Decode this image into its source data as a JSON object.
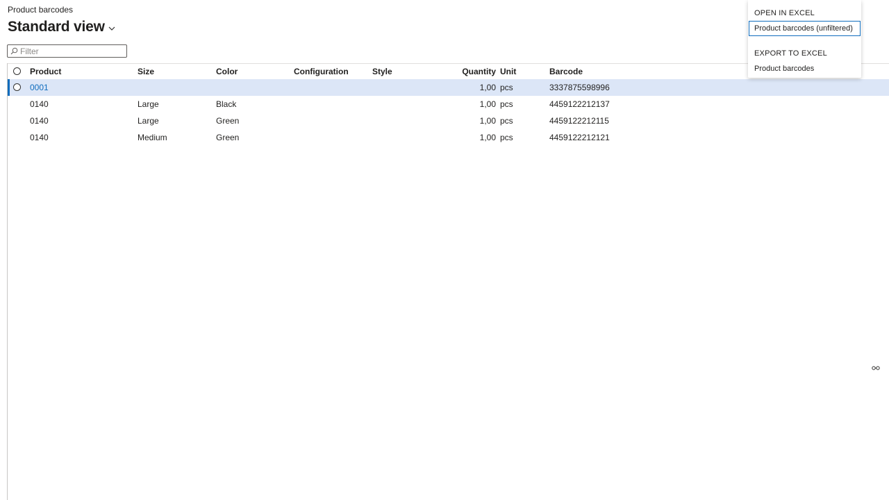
{
  "header": {
    "breadcrumb": "Product barcodes",
    "view_title": "Standard view"
  },
  "filter": {
    "placeholder": "Filter",
    "value": ""
  },
  "grid": {
    "columns": {
      "product": "Product",
      "size": "Size",
      "color": "Color",
      "configuration": "Configuration",
      "style": "Style",
      "quantity": "Quantity",
      "unit": "Unit",
      "barcode": "Barcode"
    },
    "rows": [
      {
        "product": "0001",
        "size": "",
        "color": "",
        "configuration": "",
        "style": "",
        "quantity": "1,00",
        "unit": "pcs",
        "barcode": "3337875598996"
      },
      {
        "product": "0140",
        "size": "Large",
        "color": "Black",
        "configuration": "",
        "style": "",
        "quantity": "1,00",
        "unit": "pcs",
        "barcode": "4459122212137"
      },
      {
        "product": "0140",
        "size": "Large",
        "color": "Green",
        "configuration": "",
        "style": "",
        "quantity": "1,00",
        "unit": "pcs",
        "barcode": "4459122212115"
      },
      {
        "product": "0140",
        "size": "Medium",
        "color": "Green",
        "configuration": "",
        "style": "",
        "quantity": "1,00",
        "unit": "pcs",
        "barcode": "4459122212121"
      }
    ],
    "selected_row": 0
  },
  "excel_menu": {
    "open_heading": "OPEN IN EXCEL",
    "open_item": "Product barcodes (unfiltered)",
    "export_heading": "EXPORT TO EXCEL",
    "export_item": "Product barcodes"
  },
  "icons": {
    "view_dropdown": "chevron-down-icon",
    "filter": "search-icon",
    "resize": "column-resize-icon"
  },
  "colors": {
    "accent": "#0f6cbd",
    "selected_row": "#dce6f7",
    "text": "#201f1e"
  }
}
